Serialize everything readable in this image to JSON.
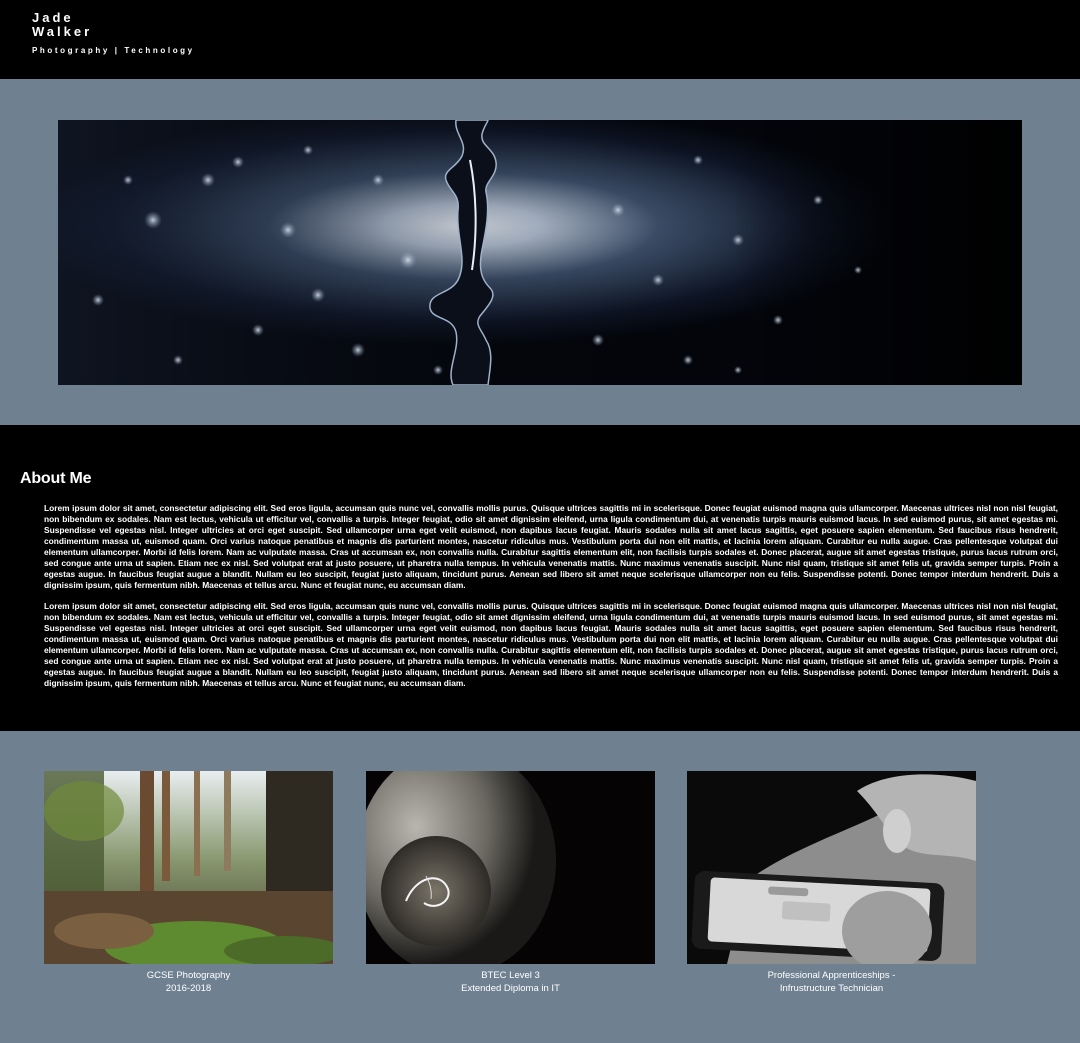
{
  "header": {
    "name_line1": "Jade",
    "name_line2": "Walker",
    "tagline": "Photography | Technology"
  },
  "hero": {
    "image_name": "water-splash-photo"
  },
  "about": {
    "title": "About Me",
    "paragraphs": [
      "Lorem ipsum dolor sit amet, consectetur adipiscing elit. Sed eros ligula, accumsan quis nunc vel, convallis mollis purus. Quisque ultrices sagittis mi in scelerisque. Donec feugiat euismod magna quis ullamcorper. Maecenas ultrices nisl non nisl feugiat, non bibendum ex sodales. Nam est lectus, vehicula ut efficitur vel, convallis a turpis. Integer feugiat, odio sit amet dignissim eleifend, urna ligula condimentum dui, at venenatis turpis mauris euismod lacus. In sed euismod purus, sit amet egestas mi. Suspendisse vel egestas nisl. Integer ultricies at orci eget suscipit. Sed ullamcorper urna eget velit euismod, non dapibus lacus feugiat. Mauris sodales nulla sit amet lacus sagittis, eget posuere sapien elementum. Sed faucibus risus hendrerit, condimentum massa ut, euismod quam. Orci varius natoque penatibus et magnis dis parturient montes, nascetur ridiculus mus. Vestibulum porta dui non elit mattis, et lacinia lorem aliquam. Curabitur eu nulla augue. Cras pellentesque volutpat dui elementum ullamcorper. Morbi id felis lorem. Nam ac vulputate massa. Cras ut accumsan ex, non convallis nulla. Curabitur sagittis elementum elit, non facilisis turpis sodales et. Donec placerat, augue sit amet egestas tristique, purus lacus rutrum orci, sed congue ante urna ut sapien. Etiam nec ex nisl. Sed volutpat erat at justo posuere, ut pharetra nulla tempus. In vehicula venenatis mattis. Nunc maximus venenatis suscipit. Nunc nisl quam, tristique sit amet felis ut, gravida semper turpis. Proin a egestas augue. In faucibus feugiat augue a blandit. Nullam eu leo suscipit, feugiat justo aliquam, tincidunt purus. Aenean sed libero sit amet neque scelerisque ullamcorper non eu felis. Suspendisse potenti. Donec tempor interdum hendrerit. Duis a dignissim ipsum, quis fermentum nibh. Maecenas et tellus arcu. Nunc et feugiat nunc, eu accumsan diam.",
      "Lorem ipsum dolor sit amet, consectetur adipiscing elit. Sed eros ligula, accumsan quis nunc vel, convallis mollis purus. Quisque ultrices sagittis mi in scelerisque. Donec feugiat euismod magna quis ullamcorper. Maecenas ultrices nisl non nisl feugiat, non bibendum ex sodales. Nam est lectus, vehicula ut efficitur vel, convallis a turpis. Integer feugiat, odio sit amet dignissim eleifend, urna ligula condimentum dui, at venenatis turpis mauris euismod lacus. In sed euismod purus, sit amet egestas mi. Suspendisse vel egestas nisl. Integer ultricies at orci eget suscipit. Sed ullamcorper urna eget velit euismod, non dapibus lacus feugiat. Mauris sodales nulla sit amet lacus sagittis, eget posuere sapien elementum. Sed faucibus risus hendrerit, condimentum massa ut, euismod quam. Orci varius natoque penatibus et magnis dis parturient montes, nascetur ridiculus mus. Vestibulum porta dui non elit mattis, et lacinia lorem aliquam. Curabitur eu nulla augue. Cras pellentesque volutpat dui elementum ullamcorper. Morbi id felis lorem. Nam ac vulputate massa. Cras ut accumsan ex, non convallis nulla. Curabitur sagittis elementum elit, non facilisis turpis sodales et. Donec placerat, augue sit amet egestas tristique, purus lacus rutrum orci, sed congue ante urna ut sapien. Etiam nec ex nisl. Sed volutpat erat at justo posuere, ut pharetra nulla tempus. In vehicula venenatis mattis. Nunc maximus venenatis suscipit. Nunc nisl quam, tristique sit amet felis ut, gravida semper turpis. Proin a egestas augue. In faucibus feugiat augue a blandit. Nullam eu leo suscipit, feugiat justo aliquam, tincidunt purus. Aenean sed libero sit amet neque scelerisque ullamcorper non eu felis. Suspendisse potenti. Donec tempor interdum hendrerit. Duis a dignissim ipsum, quis fermentum nibh. Maecenas et tellus arcu. Nunc et feugiat nunc, eu accumsan diam."
    ]
  },
  "qualifications": [
    {
      "line1": "GCSE Photography",
      "line2": "2016-2018",
      "image_name": "forest-photo"
    },
    {
      "line1": "BTEC Level 3",
      "line2": "Extended Diploma in IT",
      "image_name": "light-bulb-photo"
    },
    {
      "line1": "Professional Apprenticeships -",
      "line2": "Infrustructure Technician",
      "image_name": "phone-in-hand-photo"
    }
  ],
  "colors": {
    "band_background": "#6f8091",
    "page_background": "#000000",
    "text": "#ffffff"
  }
}
